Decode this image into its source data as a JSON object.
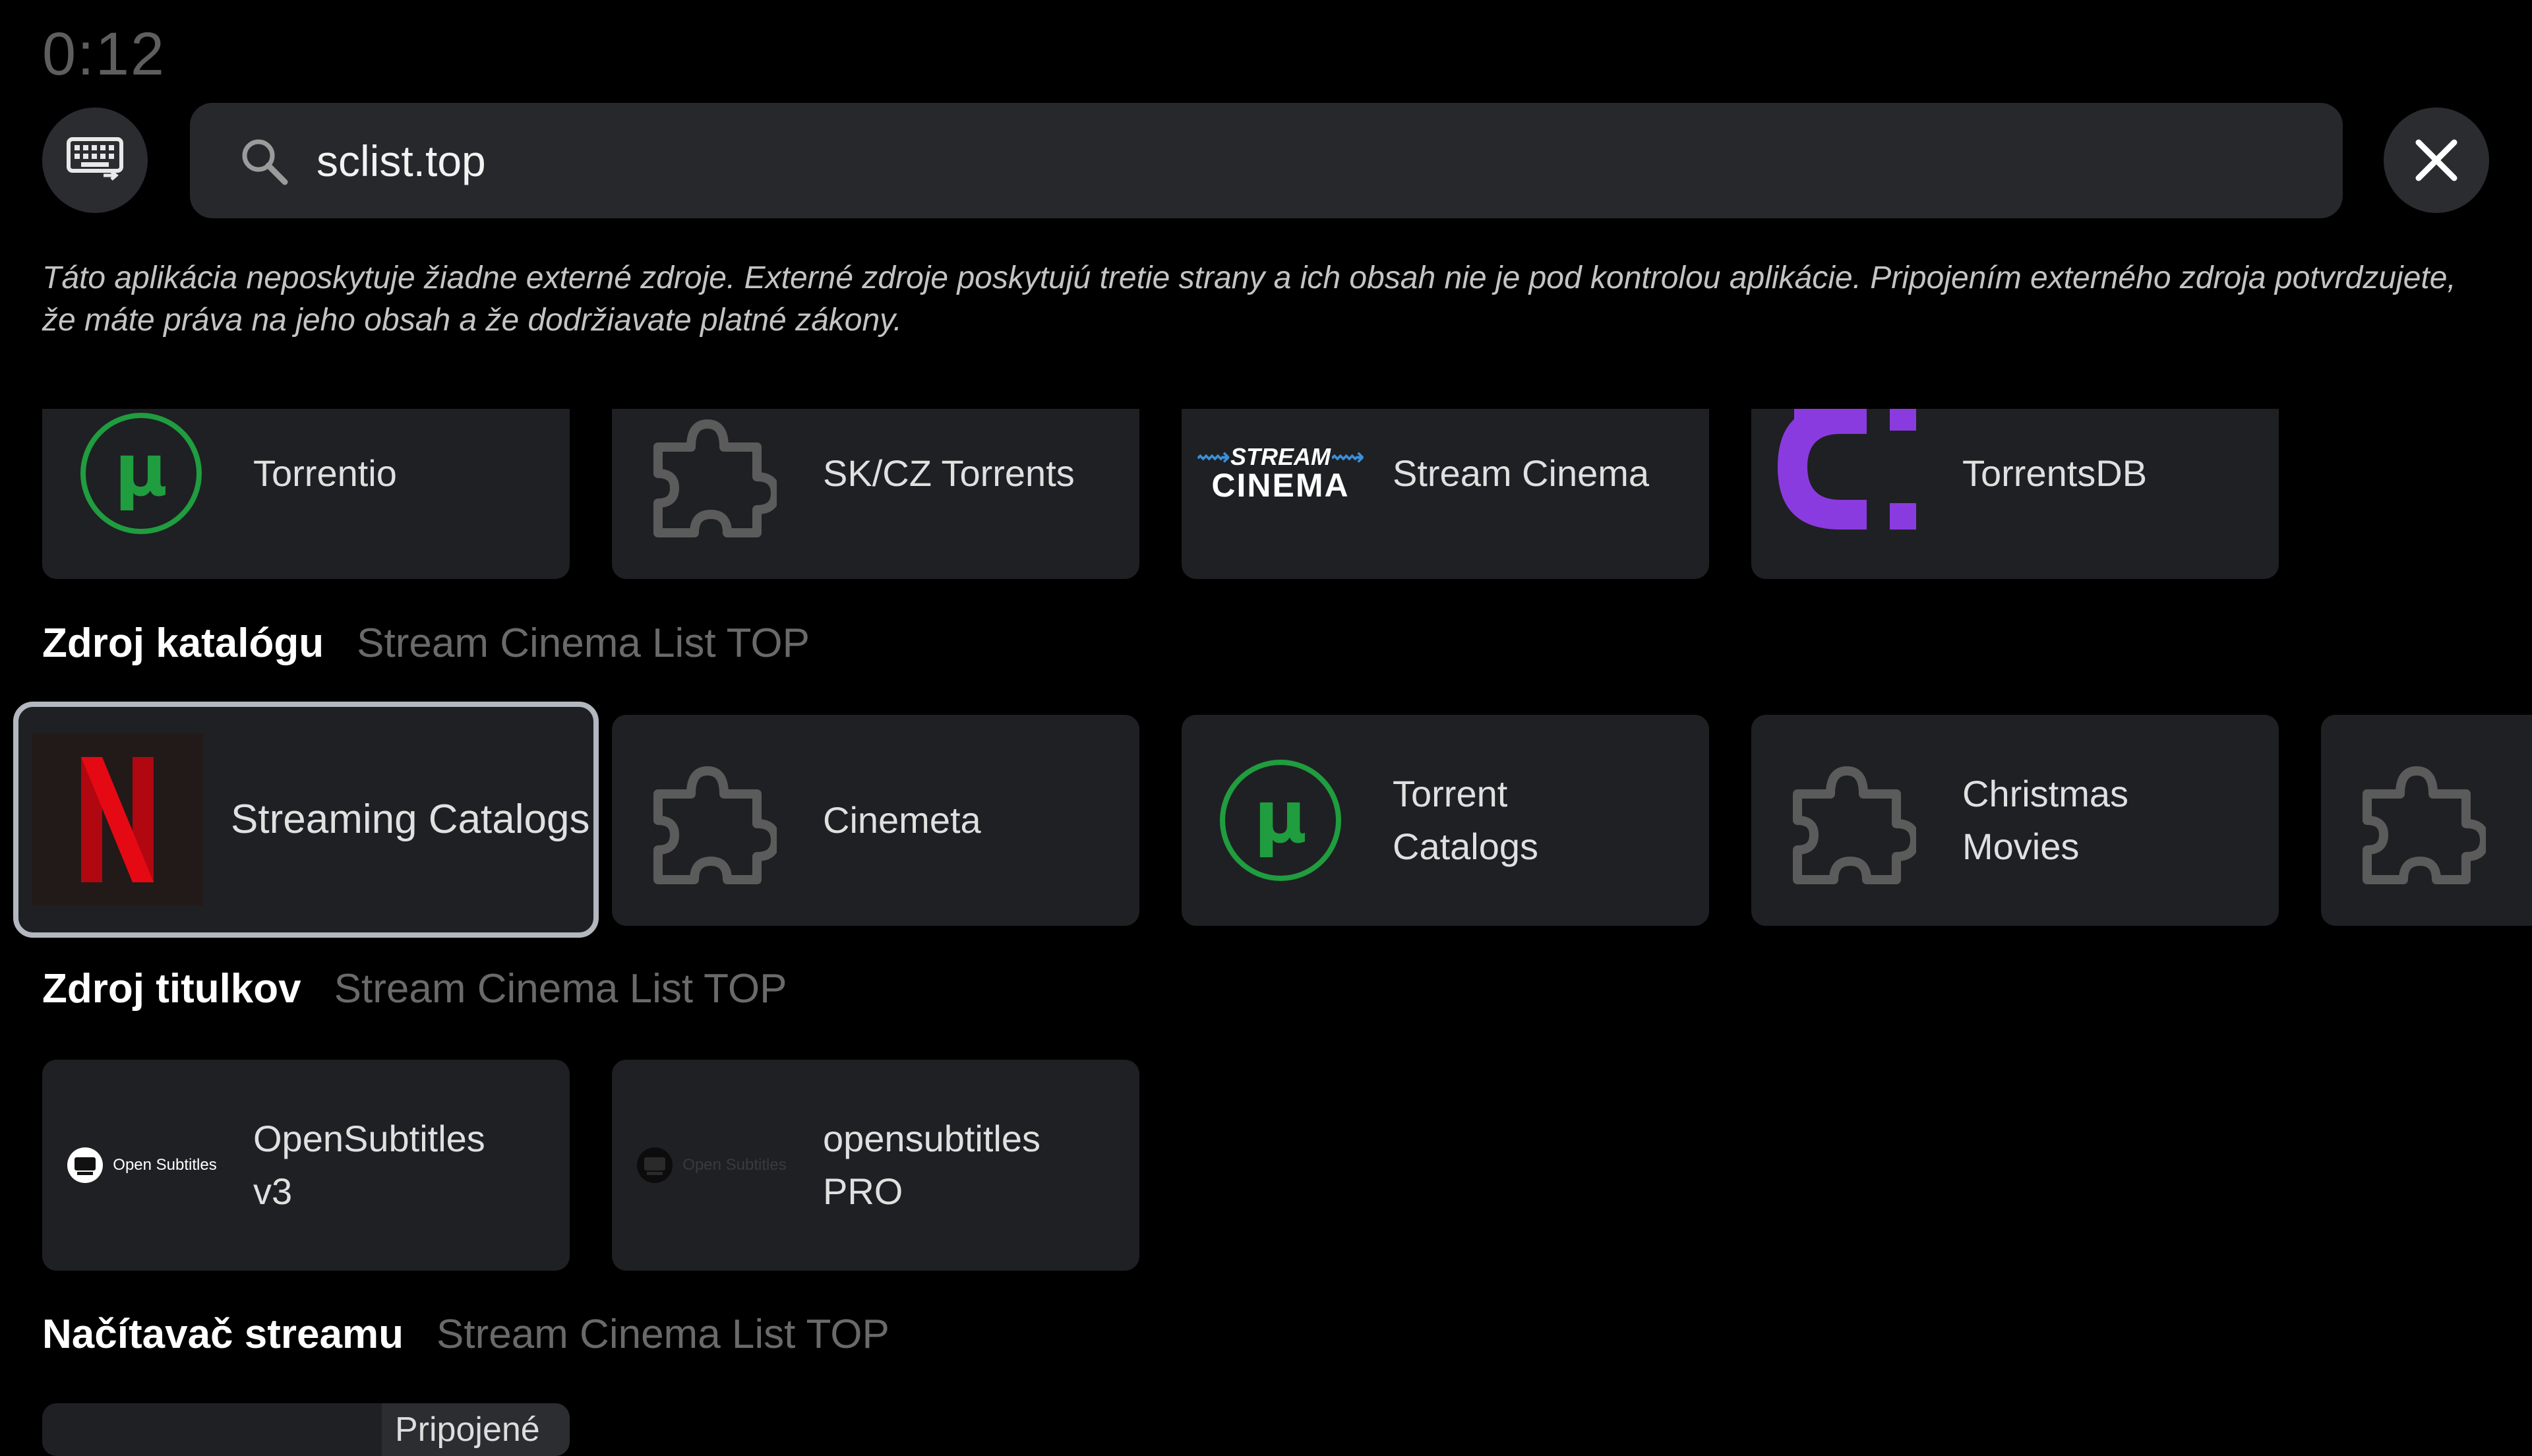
{
  "clock": "0:12",
  "search": {
    "value": "sclist.top",
    "keyboard_icon": "keyboard-icon",
    "search_icon": "search-icon",
    "close_icon": "close-icon"
  },
  "disclaimer": "Táto aplikácia neposkytuje žiadne externé zdroje. Externé zdroje poskytujú tretie strany a ich obsah nie je pod kontrolou aplikácie. Pripojením externého zdroja potvrdzujete, že máte práva na jeho obsah a že dodržiavate platné zákony.",
  "stream_row": {
    "items": [
      {
        "label": "Torrentio",
        "icon": "utorrent-icon"
      },
      {
        "label": "SK/CZ Torrents",
        "icon": "puzzle-icon"
      },
      {
        "label": "Stream Cinema",
        "icon": "stream-cinema-logo",
        "logo_text_top": "STREAM",
        "logo_text_bottom": "CINEMA"
      },
      {
        "label": "TorrentsDB",
        "icon": "torrentsdb-logo"
      }
    ]
  },
  "catalog_section": {
    "title": "Zdroj katalógu",
    "subtitle": "Stream Cinema List TOP",
    "items": [
      {
        "label": "Streaming Catalogs",
        "icon": "netflix-logo"
      },
      {
        "label": "Cinemeta",
        "icon": "puzzle-icon"
      },
      {
        "label": "Torrent Catalogs",
        "icon": "utorrent-icon"
      },
      {
        "label": "Christmas Movies",
        "icon": "puzzle-icon"
      },
      {
        "label": "",
        "icon": "puzzle-icon"
      }
    ]
  },
  "subtitles_section": {
    "title": "Zdroj titulkov",
    "subtitle": "Stream Cinema List TOP",
    "items": [
      {
        "label": "OpenSubtitles v3",
        "icon": "opensubtitles-logo",
        "logo_text": "Open Subtitles"
      },
      {
        "label": "opensubtitles PRO",
        "icon": "opensubtitles-logo",
        "logo_text": "Open Subtitles"
      }
    ]
  },
  "stream_section": {
    "title": "Načítavač streamu",
    "subtitle": "Stream Cinema List TOP",
    "peek_label": "Pripojené"
  },
  "colors": {
    "background": "#000000",
    "card": "#1f2023",
    "focus_border": "#b3b7bf",
    "utorrent_green": "#1f9d3f",
    "torrentsdb_purple": "#8a3be0",
    "netflix_red": "#e50914"
  }
}
